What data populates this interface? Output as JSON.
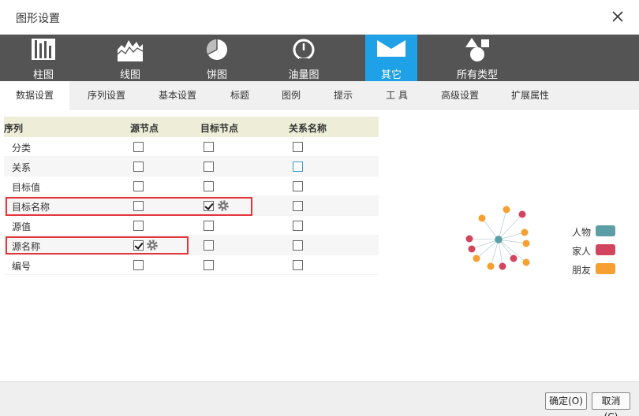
{
  "window": {
    "title": "图形设置"
  },
  "chart_types": [
    {
      "label": "柱图",
      "icon": "bar-chart-icon"
    },
    {
      "label": "线图",
      "icon": "line-chart-icon"
    },
    {
      "label": "饼图",
      "icon": "pie-chart-icon"
    },
    {
      "label": "油量图",
      "icon": "gauge-icon"
    },
    {
      "label": "其它",
      "icon": "other-chart-icon",
      "active": true
    },
    {
      "label": "所有类型",
      "icon": "all-types-icon"
    }
  ],
  "subtabs": [
    "数据设置",
    "序列设置",
    "基本设置",
    "标题",
    "图例",
    "提示",
    "工 具",
    "高级设置",
    "扩展属性"
  ],
  "grid": {
    "headers": [
      "序列",
      "源节点",
      "目标节点",
      "关系名称"
    ],
    "rows": [
      {
        "name": "分类",
        "source": false,
        "target": false,
        "relation": false
      },
      {
        "name": "关系",
        "source": false,
        "target": false,
        "relation": false
      },
      {
        "name": "目标值",
        "source": false,
        "target": false,
        "relation": false
      },
      {
        "name": "目标名称",
        "source": false,
        "target": true,
        "relation": false
      },
      {
        "name": "源值",
        "source": false,
        "target": false,
        "relation": false
      },
      {
        "name": "源名称",
        "source": true,
        "target": false,
        "relation": false
      },
      {
        "name": "编号",
        "source": false,
        "target": false,
        "relation": false
      }
    ]
  },
  "legend": [
    {
      "label": "人物",
      "color": "#5b9ea6"
    },
    {
      "label": "家人",
      "color": "#d2455f"
    },
    {
      "label": "朋友",
      "color": "#f5a031"
    }
  ],
  "colors": {
    "active_tab": "#1ea1e6",
    "highlight": "#e0353a"
  },
  "buttons": {
    "ok": "确定(O)",
    "cancel": "取消(C)"
  }
}
